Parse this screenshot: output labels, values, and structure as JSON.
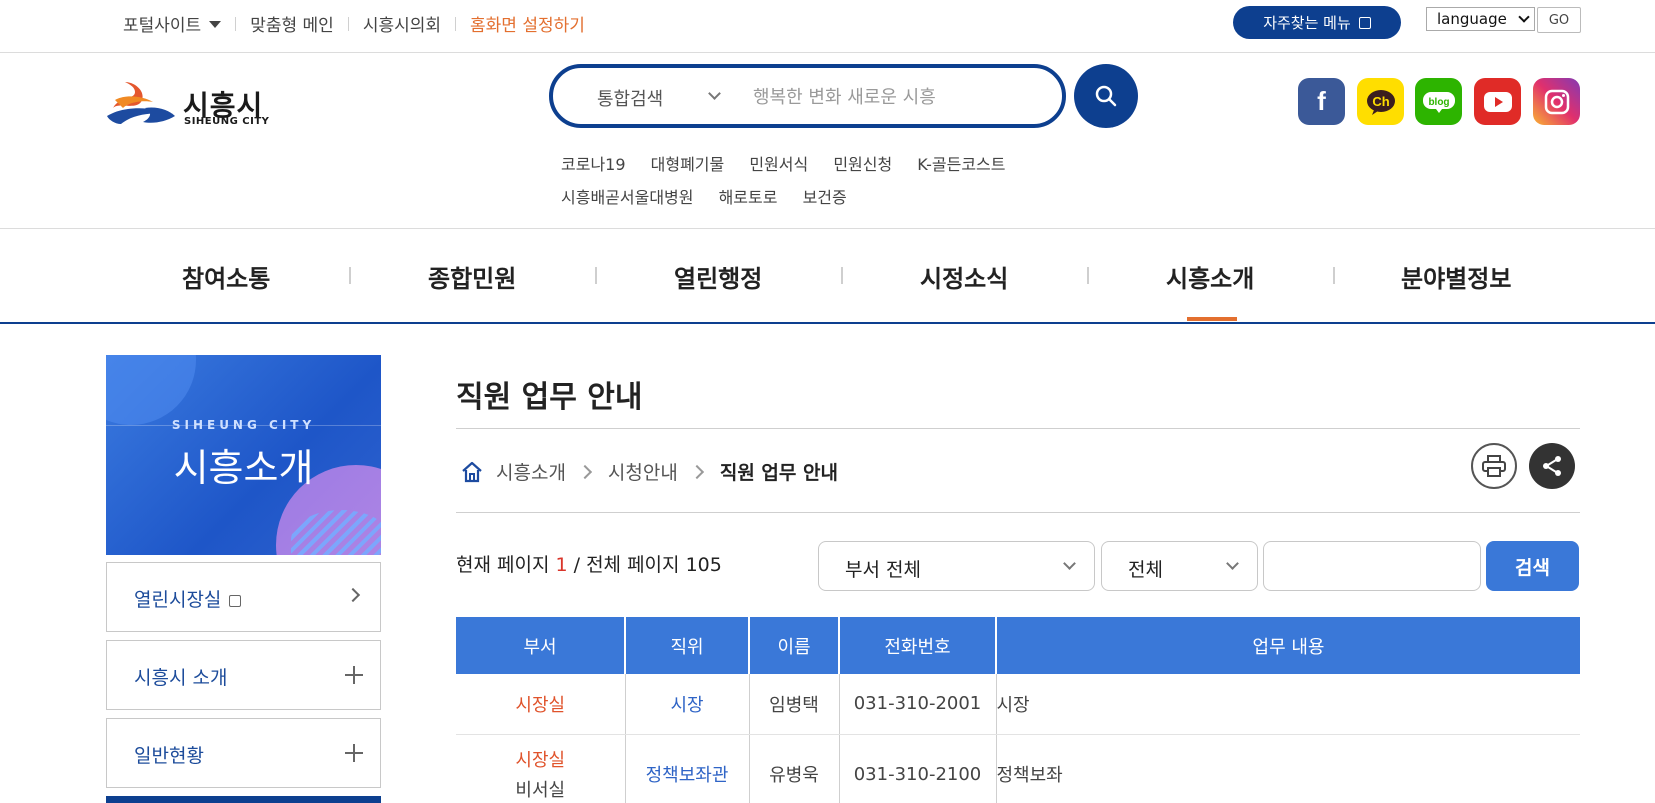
{
  "topbar": {
    "portal": "포털사이트",
    "custom_main": "맞춤형 메인",
    "council": "시흥시의회",
    "set_home": "홈화면 설정하기",
    "fav_menu": "자주찾는 메뉴",
    "language": "language",
    "go": "GO"
  },
  "logo": {
    "name_ko": "시흥시",
    "name_en": "SIHEUNG CITY"
  },
  "search": {
    "category": "통합검색",
    "placeholder": "행복한 변화 새로운 시흥",
    "keywords": [
      "코로나19",
      "대형폐기물",
      "민원서식",
      "민원신청",
      "K-골든코스트",
      "시흥배곧서울대병원",
      "해로토로",
      "보건증"
    ]
  },
  "sns": {
    "facebook_icon": "facebook-icon",
    "kakao_icon": "kakao-channel-icon",
    "kakao_text": "Ch",
    "blog_icon": "blog-icon",
    "blog_text": "blog",
    "youtube_icon": "youtube-icon",
    "instagram_icon": "instagram-icon"
  },
  "gnb": [
    "참여소통",
    "종합민원",
    "열린행정",
    "시정소식",
    "시흥소개",
    "분야별정보"
  ],
  "gnb_active": "시흥소개",
  "side": {
    "hero_sub": "SIHEUNG CITY",
    "hero_title": "시흥소개",
    "items": [
      {
        "label": "열린시장실",
        "type": "external"
      },
      {
        "label": "시흥시 소개",
        "type": "expand"
      },
      {
        "label": "일반현황",
        "type": "expand"
      }
    ]
  },
  "content": {
    "title": "직원 업무 안내",
    "breadcrumb": [
      "시흥소개",
      "시청안내",
      "직원 업무 안내"
    ],
    "page_info": {
      "prefix": "현재 페이지",
      "current": "1",
      "sep": "/ 전체 페이지",
      "total": "105"
    },
    "dept_select": "부서 전체",
    "type_select": "전체",
    "search_button": "검색"
  },
  "table": {
    "headers": [
      "부서",
      "직위",
      "이름",
      "전화번호",
      "업무 내용"
    ],
    "rows": [
      {
        "dept": "시장실",
        "dept_sub": "",
        "position": "시장",
        "name": "임병택",
        "phone": "031-310-2001",
        "duty": "시장"
      },
      {
        "dept": "시장실",
        "dept_sub": "비서실",
        "position": "정책보좌관",
        "name": "유병욱",
        "phone": "031-310-2100",
        "duty": "정책보좌"
      }
    ]
  },
  "colors": {
    "brand_navy": "#0d3f8f",
    "accent_orange": "#e36f2f",
    "table_blue": "#3a78d8"
  }
}
